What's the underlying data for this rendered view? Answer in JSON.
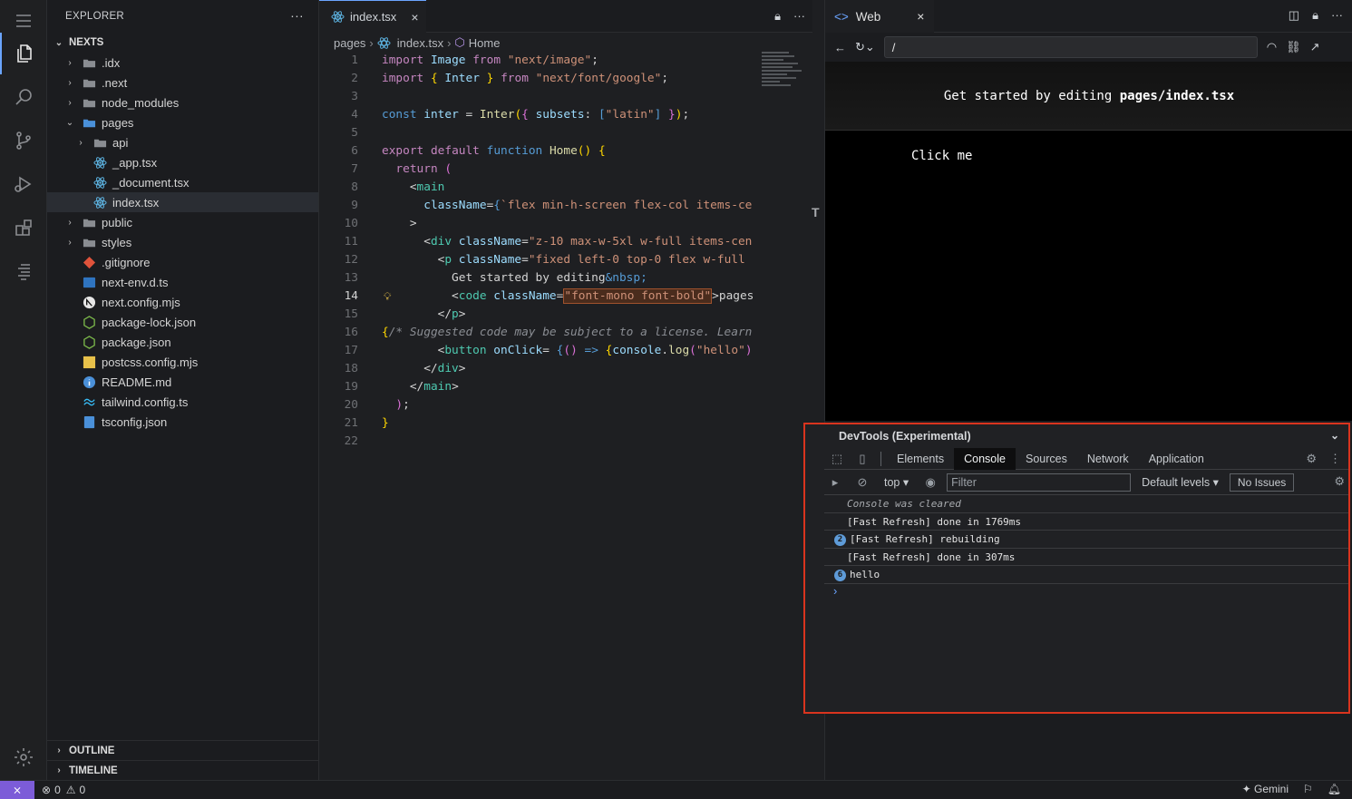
{
  "activity": {
    "items": [
      "menu-icon",
      "files-icon",
      "search-icon",
      "source-control-icon",
      "run-debug-icon",
      "extensions-icon",
      "outline-list-icon",
      "settings-gear-icon"
    ]
  },
  "sidebar": {
    "title": "EXPLORER",
    "more": "···",
    "project": "NEXTS",
    "tree": [
      {
        "label": ".idx",
        "kind": "folder",
        "chev": "›"
      },
      {
        "label": ".next",
        "kind": "folder",
        "chev": "›"
      },
      {
        "label": "node_modules",
        "kind": "folder",
        "chev": "›"
      },
      {
        "label": "pages",
        "kind": "folder-open",
        "chev": "⌄"
      },
      {
        "label": "api",
        "kind": "folder",
        "chev": "›"
      },
      {
        "label": "_app.tsx",
        "kind": "react"
      },
      {
        "label": "_document.tsx",
        "kind": "react"
      },
      {
        "label": "index.tsx",
        "kind": "react"
      },
      {
        "label": "public",
        "kind": "folder",
        "chev": "›"
      },
      {
        "label": "styles",
        "kind": "folder",
        "chev": "›"
      },
      {
        "label": ".gitignore",
        "kind": "git"
      },
      {
        "label": "next-env.d.ts",
        "kind": "ts"
      },
      {
        "label": "next.config.mjs",
        "kind": "next"
      },
      {
        "label": "package-lock.json",
        "kind": "npm"
      },
      {
        "label": "package.json",
        "kind": "npm"
      },
      {
        "label": "postcss.config.mjs",
        "kind": "js"
      },
      {
        "label": "README.md",
        "kind": "info"
      },
      {
        "label": "tailwind.config.ts",
        "kind": "tailwind"
      },
      {
        "label": "tsconfig.json",
        "kind": "tsconfig"
      }
    ],
    "outline": "OUTLINE",
    "timeline": "TIMELINE"
  },
  "editor": {
    "tab_label": "index.tsx",
    "tab_close": "×",
    "breadcrumb": {
      "folder": "pages",
      "file": "index.tsx",
      "symbol": "Home"
    },
    "active_line": 14
  },
  "web": {
    "tab_label": "Web",
    "tab_close": "×",
    "url": "/",
    "banner_text": "Get started by editing ",
    "banner_code": "pages/index.tsx",
    "button_label": "Click me"
  },
  "devtools": {
    "title": "DevTools (Experimental)",
    "tabs": [
      "Elements",
      "Console",
      "Sources",
      "Network",
      "Application"
    ],
    "active_tab": "Console",
    "context": "top ▾",
    "filter_placeholder": "Filter",
    "levels": "Default levels ▾",
    "issues": "No Issues",
    "console": [
      {
        "text": "Console was cleared",
        "italic": true
      },
      {
        "text": "[Fast Refresh] done in 1769ms"
      },
      {
        "text": "[Fast Refresh] rebuilding",
        "count": "2"
      },
      {
        "text": "[Fast Refresh] done in 307ms"
      },
      {
        "text": "hello",
        "count": "6"
      }
    ],
    "prompt": "›"
  },
  "status": {
    "errors": "0",
    "warnings": "0",
    "gemini": "Gemini"
  },
  "colors": {
    "accent": "#6ba4ff",
    "highlight_border": "#d9341e",
    "remote": "#7c5cd8"
  }
}
